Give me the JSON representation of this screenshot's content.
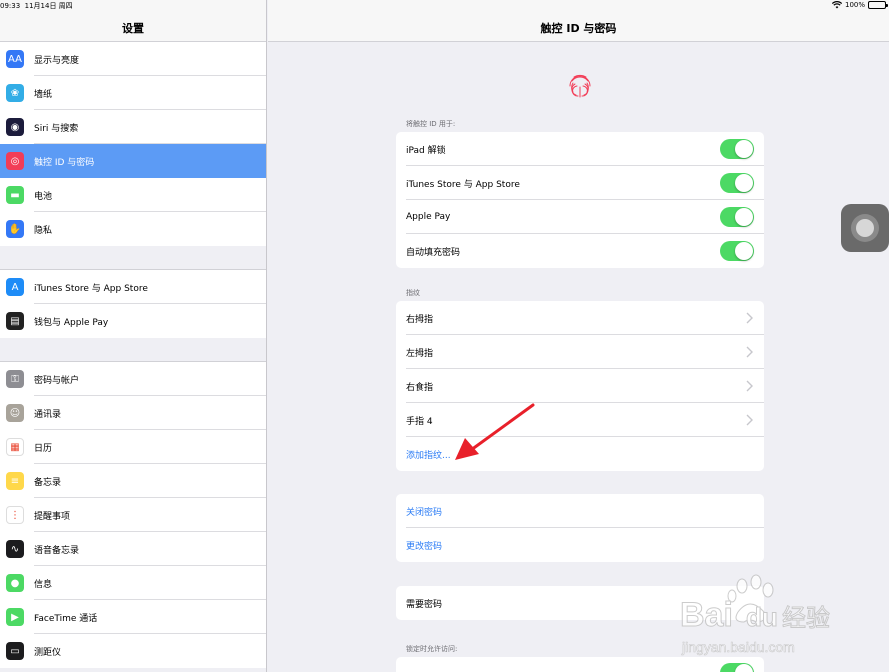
{
  "status_bar": {
    "time": "09:33",
    "date": "11月14日 周四",
    "battery": "100%",
    "wifi_icon": "wifi-icon"
  },
  "sidebar": {
    "title": "设置",
    "groups": [
      [
        {
          "label": "显示与亮度",
          "icon": "display-brightness-icon",
          "color": "#3478f6",
          "glyph": "AA"
        },
        {
          "label": "墙纸",
          "icon": "wallpaper-icon",
          "color": "#32ade6",
          "glyph": "❀"
        },
        {
          "label": "Siri 与搜索",
          "icon": "siri-icon",
          "color": "#1c1c3c",
          "glyph": "◉"
        },
        {
          "label": "触控 ID 与密码",
          "icon": "touch-id-icon",
          "color": "#f23d57",
          "glyph": "◎",
          "selected": true
        },
        {
          "label": "电池",
          "icon": "battery-icon",
          "color": "#4cd964",
          "glyph": "▬"
        },
        {
          "label": "隐私",
          "icon": "privacy-hand-icon",
          "color": "#3478f6",
          "glyph": "✋"
        }
      ],
      [
        {
          "label": "iTunes Store 与 App Store",
          "icon": "app-store-icon",
          "color": "#1e8cf7",
          "glyph": "A"
        },
        {
          "label": "钱包与 Apple Pay",
          "icon": "wallet-icon",
          "color": "#222222",
          "glyph": "▤"
        }
      ],
      [
        {
          "label": "密码与帐户",
          "icon": "passwords-key-icon",
          "color": "#8e8e93",
          "glyph": "⚿"
        },
        {
          "label": "通讯录",
          "icon": "contacts-icon",
          "color": "#a8a39a",
          "glyph": "☺"
        },
        {
          "label": "日历",
          "icon": "calendar-icon",
          "color": "#ffffff",
          "glyph": "▦"
        },
        {
          "label": "备忘录",
          "icon": "notes-icon",
          "color": "#ffd84a",
          "glyph": "≡"
        },
        {
          "label": "提醒事项",
          "icon": "reminders-icon",
          "color": "#ffffff",
          "glyph": "⋮"
        },
        {
          "label": "语音备忘录",
          "icon": "voice-memos-icon",
          "color": "#1c1c1e",
          "glyph": "∿"
        },
        {
          "label": "信息",
          "icon": "messages-icon",
          "color": "#4cd964",
          "glyph": "●"
        },
        {
          "label": "FaceTime 通话",
          "icon": "facetime-icon",
          "color": "#4cd964",
          "glyph": "▶"
        },
        {
          "label": "测距仪",
          "icon": "measure-icon",
          "color": "#1c1c1e",
          "glyph": "▭"
        }
      ]
    ]
  },
  "main": {
    "title": "触控 ID 与密码",
    "use_for_label": "将触控 ID 用于:",
    "use_for": [
      {
        "label": "iPad 解锁",
        "on": true
      },
      {
        "label": "iTunes Store 与 App Store",
        "on": true
      },
      {
        "label": "Apple Pay",
        "on": true
      },
      {
        "label": "自动填充密码",
        "on": true
      }
    ],
    "fingerprints_label": "指纹",
    "fingerprints": [
      "右拇指",
      "左拇指",
      "右食指",
      "手指 4"
    ],
    "add_fingerprint": "添加指纹...",
    "passcode_actions": [
      "关闭密码",
      "更改密码"
    ],
    "require_passcode": "需要密码",
    "lock_access_label": "锁定时允许访问:"
  },
  "watermark": {
    "brand": "Bai",
    "brand2": "du",
    "text": "经验",
    "url": "jingyan.baidu.com"
  },
  "colors": {
    "accent": "#2a7bf5",
    "switch_on": "#4cd964",
    "selected_row": "#5c9bf5"
  }
}
